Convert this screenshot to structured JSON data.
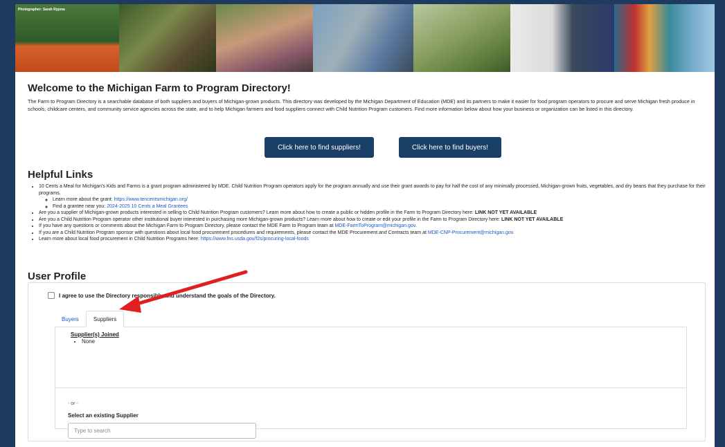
{
  "banner": {
    "photo_credit": "Photographer: Sarah Rypma"
  },
  "intro": {
    "title": "Welcome to the Michigan Farm to Program Directory!",
    "text": "The Farm to Program Directory is a searchable database of both suppliers and buyers of Michigan-grown products. This directory was developed by the Michigan Department of Education (MDE) and its partners to make it easier for food program operators to procure and serve Michigan fresh produce in schools, childcare centers, and community service agencies across the state, and to help Michigan farmers and food suppliers connect with Child Nutrition Program customers. Find more information below about how your business or organization can be listed in this directory."
  },
  "buttons": {
    "find_suppliers": "Click here to find suppliers!",
    "find_buyers": "Click here to find buyers!"
  },
  "helpful_links": {
    "title": "Helpful Links",
    "item1": "10 Cents a Meal for Michigan's Kids and Farms is a grant program administered by MDE. Child Nutrition Program operators apply for the program annually and use their grant awards to pay for half the cost of any minimally processed, Michigan-grown fruits, vegetables, and dry beans that they purchase for their programs.",
    "sub1_text": "Learn more about the grant: ",
    "sub1_link": "https://www.tencentsmichigan.org/",
    "sub2_text": "Find a grantee near you: ",
    "sub2_link": "2024-2025 10 Cents a Meal Grantees",
    "item2_text": "Are you a supplier of Michigan-grown products interested in selling to Child Nutrition Program customers? Learn more about how to create a public or hidden profile in the Farm to Program Directory here: ",
    "item2_bold": "LINK NOT YET AVAILABLE",
    "item3_text": "Are you a Child Nutrition Program operator other institutional buyer interested in purchasing more Michigan-grown products? Learn more about how to create or edit your profile in the Farm to Program Directory here: ",
    "item3_bold": "LINK NOT YET AVAILABLE",
    "item4_text": "If you have any questions or comments about the Michigan Farm to Program Directory, please contact the MDE Farm to Program team at ",
    "item4_link": "MDE-FarmToProgram@michigan.gov",
    "item4_end": ".",
    "item5_text": "If you are a Child Nutrition Program sponsor with questions about local food procurement procedures and requirements, please contact the MDE Procurement and Contracts team at ",
    "item5_link": "MDE-CNP-Procurement@michigan.gov",
    "item5_end": ".",
    "item6_text": "Learn more about local food procurement in Child Nutrition Programs here: ",
    "item6_link": "https://www.fns.usda.gov/f2s/procuring-local-foods"
  },
  "user_profile": {
    "title": "User Profile",
    "agree_label": "I agree to use the Directory responsibly and understand the goals of the Directory.",
    "agree_checked": false,
    "tabs": [
      {
        "label": "Buyers",
        "active": false
      },
      {
        "label": "Suppliers",
        "active": true
      }
    ],
    "joined_heading": "Supplier(s) Joined",
    "joined_items": [
      "None"
    ],
    "or_text": "- or -",
    "select_label": "Select an existing Supplier",
    "search_placeholder": "Type to search",
    "search_value": ""
  },
  "colors": {
    "background": "#1e3a5f",
    "button": "#1a3f66",
    "link": "#1a56c4",
    "arrow": "#e02020"
  }
}
